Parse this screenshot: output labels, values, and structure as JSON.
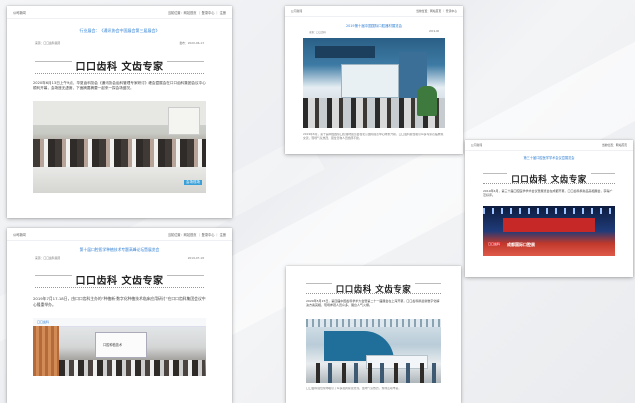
{
  "cards": [
    {
      "header_left": "公司新闻",
      "header_right": "当前位置：网站首页 ｜ 登录中心 ｜ 注册",
      "title": "行业展会：《通讯协会中国展会第三届展会》",
      "source": "来源：口口齿科集团",
      "date": "发布：2020-06-13",
      "banner": "口口齿科 文齿专家",
      "paragraph": "2020年6月13日上午9点，华夏齿科协会《通讯协会齿科管理专家研讨》峰会暨展会在口口齿科集团会议中心顺利开幕，会场座无虚席，下面摘要摘要一起来一探会场盛况。",
      "caption": "会场现场"
    },
    {
      "header_left": "公司新闻",
      "header_right": "当前位置：网站首页 ｜ 登录中心",
      "title": "2019第十届中国国际口腔器材展览会",
      "source": "来源：口口齿科",
      "date": "2019-06",
      "paragraph": "2019年6月，第十届中国国际口腔器材展览会在北京国际展览中心隆重开幕，口口齿科展位吸引众多专家莅临参观交流，现场气氛热烈，展位咨询人员络绎不绝。"
    },
    {
      "header_left": "公司新闻",
      "header_right": "当前位置：网站首页",
      "title": "第三十届口腔医学学术会议暨展览会",
      "banner": "口口齿科 文齿专家",
      "paragraph": "2019年4月，第三十届口腔医学学术会议暨展览会在成都开幕，口口齿科携新品亮相展会，获得广泛好评。",
      "stage_text": "成都国际口腔展",
      "stage_logo": "口口齿科"
    },
    {
      "header_left": "公司新闻",
      "header_right": "当前位置：网站首页 ｜ 登录中心 ｜ 注册",
      "title": "第十届口腔医学种植技术专题高峰论坛暨展览会",
      "source": "来源：口口齿科集团",
      "date": "2019-07-18",
      "banner": "口口齿科 文齿专家",
      "paragraph": "2019年7月17-18日，由口口齿科主办的“种植新·数字化种植技术临床应用研讨”在口口齿科集团会议中心隆重举办。",
      "screen_label": "口腔种植技术",
      "logo_text": "口口齿科"
    },
    {
      "banner": "口口齿科 文齿专家",
      "paragraph": "2020年5月15日，第四届中国齿科学术大会暨第二十一届展会在上海开幕，口口齿科携最新数字化解决方案亮相，现场参观人员众多，展台人气火爆。",
      "footer_note": "口口齿科展位现场吸引了众多嘉宾驻足交流，会场气氛热烈，现场互动丰富。"
    }
  ]
}
